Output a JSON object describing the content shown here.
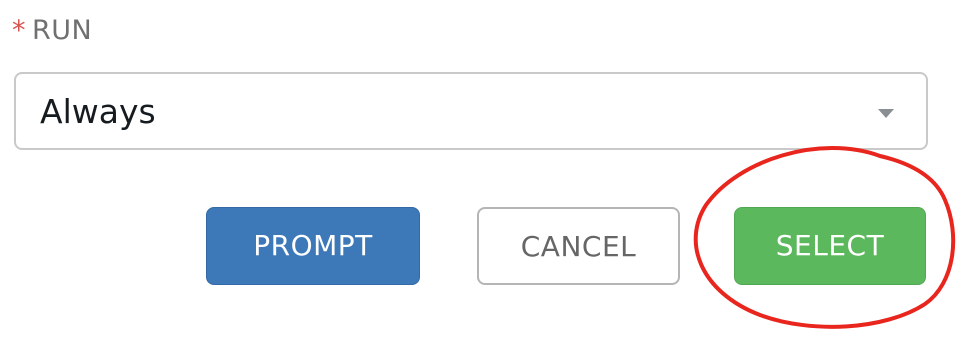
{
  "form": {
    "run_label": "RUN",
    "required_marker": "*",
    "run_select": {
      "selected": "Always"
    }
  },
  "actions": {
    "prompt_label": "PROMPT",
    "cancel_label": "CANCEL",
    "select_label": "SELECT"
  },
  "colors": {
    "required_asterisk": "#d9534f",
    "prompt_button": "#3d78b8",
    "select_button": "#5cb85c",
    "annotation_ring": "#e8261e"
  },
  "icons": {
    "select_caret": "chevron-down-icon"
  }
}
